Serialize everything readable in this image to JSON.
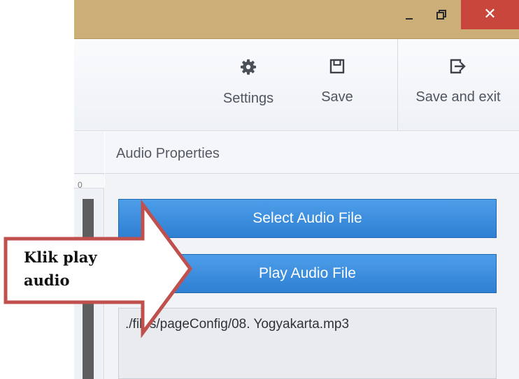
{
  "window": {
    "minimize_icon": "minimize-icon",
    "maximize_icon": "restore-icon",
    "close_icon": "close-icon",
    "close_glyph": "✕"
  },
  "toolbar": {
    "settings_label": "Settings",
    "save_label": "Save",
    "save_exit_label": "Save and exit",
    "settings_icon": "gear-icon",
    "save_icon": "floppy-disk-icon",
    "save_exit_icon": "exit-icon"
  },
  "ruler": {
    "tick": "0"
  },
  "panel": {
    "title": "Audio Properties",
    "select_button": "Select Audio File",
    "play_button": "Play Audio File",
    "file_path": "./files/pageConfig/08. Yogyakarta.mp3"
  },
  "annotation": {
    "line1": "Klik play",
    "line2": "audio",
    "fill_color": "#ffffff",
    "stroke_color": "#c0504d"
  },
  "colors": {
    "titlebar": "#cbae78",
    "close_button": "#c9463d",
    "button_blue": "#3a8ce0"
  }
}
